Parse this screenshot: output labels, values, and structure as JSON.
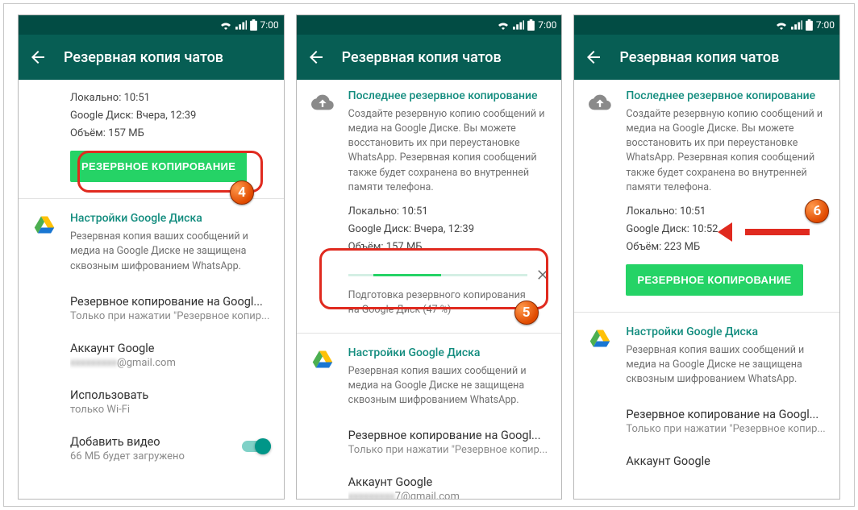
{
  "status_bar": {
    "time": "7:00"
  },
  "app_bar": {
    "title": "Резервная копия чатов"
  },
  "screens": [
    {
      "info": {
        "local_label": "Локально:",
        "local_value": "10:51",
        "gdrive_label": "Google Диск:",
        "gdrive_value": "Вчера, 12:39",
        "size_label": "Объём:",
        "size_value": "157 МБ"
      },
      "backup_btn": "РЕЗЕРВНОЕ КОПИРОВАНИЕ",
      "gdrive_settings": {
        "header": "Настройки Google Диска",
        "desc": "Резервная копия ваших сообщений и медиа на Google Диске не защищена сквозным шифрованием WhatsApp."
      },
      "items": {
        "backup_to": {
          "title": "Резервное копирование на Googl...",
          "sub": "Только при нажатии \"Резервное копир..."
        },
        "account": {
          "title": "Аккаунт Google",
          "sub_suffix": "@gmail.com",
          "sub_blur": "xxxxxxxxx"
        },
        "network": {
          "title": "Использовать",
          "sub": "только Wi-Fi"
        },
        "video": {
          "title": "Добавить видео",
          "sub": "66 МБ будет загружено"
        }
      }
    },
    {
      "last_backup": {
        "header": "Последнее резервное копирование",
        "desc": "Создайте резервную копию сообщений и медиа на Google Диске. Вы можете восстановить их при переустановке WhatsApp. Резервная копия сообщений также будет сохранена во внутренней памяти телефона."
      },
      "info": {
        "local_label": "Локально:",
        "local_value": "10:51",
        "gdrive_label": "Google Диск:",
        "gdrive_value": "Вчера, 12:39",
        "size_label": "Объём:",
        "size_value": "157 МБ"
      },
      "progress": {
        "text_line1": "Подготовка резервного копирования",
        "text_line2": "на Google Диск (47 %)"
      },
      "gdrive_settings": {
        "header": "Настройки Google Диска",
        "desc": "Резервная копия ваших сообщений и медиа на Google Диске не защищена сквозным шифрованием WhatsApp."
      },
      "items": {
        "backup_to": {
          "title": "Резервное копирование на Googl...",
          "sub": "Только при нажатии \"Резервное копир..."
        },
        "account": {
          "title": "Аккаунт Google",
          "sub_suffix": "7@gmail.com",
          "sub_blur": "xxxxxxxxx"
        }
      }
    },
    {
      "last_backup": {
        "header": "Последнее резервное копирование",
        "desc": "Создайте резервную копию сообщений и медиа на Google Диске. Вы можете восстановить их при переустановке WhatsApp. Резервная копия сообщений также будет сохранена во внутренней памяти телефона."
      },
      "info": {
        "local_label": "Локально:",
        "local_value": "10:51",
        "gdrive_label": "Google Диск:",
        "gdrive_value": "10:52",
        "size_label": "Объём:",
        "size_value": "223 МБ"
      },
      "backup_btn": "РЕЗЕРВНОЕ КОПИРОВАНИЕ",
      "gdrive_settings": {
        "header": "Настройки Google Диска",
        "desc": "Резервная копия ваших сообщений и медиа на Google Диске не защищена сквозным шифрованием WhatsApp."
      },
      "items": {
        "backup_to": {
          "title": "Резервное копирование на Googl...",
          "sub": "Только при нажатии \"Резервное копир..."
        },
        "account": {
          "title": "Аккаунт Google"
        }
      }
    }
  ],
  "badges": {
    "b4": "4",
    "b5": "5",
    "b6": "6"
  }
}
